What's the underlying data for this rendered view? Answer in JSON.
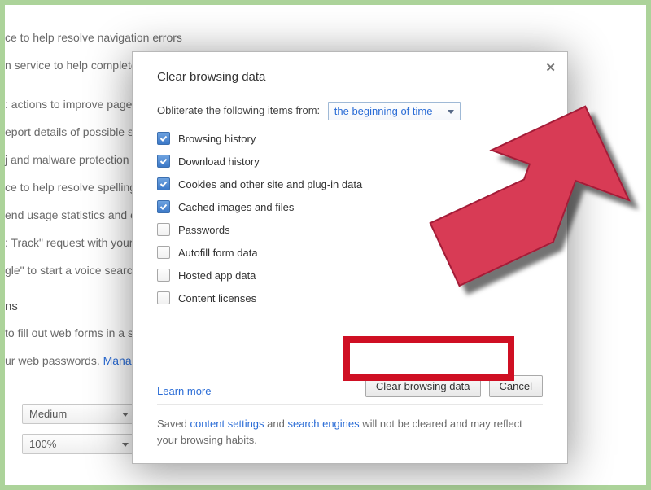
{
  "background": {
    "lines": {
      "l1": "ce to help resolve navigation errors",
      "l2": "n service to help complete seai",
      "l3": ": actions to improve page load",
      "l4": "eport details of possible secur",
      "l5": "j and malware protection",
      "l6": "ce to help resolve spelling err",
      "l7": "end usage statistics and crash",
      "l8": ": Track\" request with your bro",
      "l9": "gle\" to start a voice search",
      "l10": "ns",
      "l11": "to fill out web forms in a singl",
      "l12_a": "ur web passwords.  ",
      "l12_b": "Manage p"
    },
    "dropdowns": {
      "medium": "Medium",
      "zoom": "100%"
    }
  },
  "modal": {
    "title": "Clear browsing data",
    "obliterate_label": "Obliterate the following items from:",
    "time_range": "the beginning of time",
    "options": [
      {
        "label": "Browsing history",
        "checked": true
      },
      {
        "label": "Download history",
        "checked": true
      },
      {
        "label": "Cookies and other site and plug-in data",
        "checked": true
      },
      {
        "label": "Cached images and files",
        "checked": true
      },
      {
        "label": "Passwords",
        "checked": false
      },
      {
        "label": "Autofill form data",
        "checked": false
      },
      {
        "label": "Hosted app data",
        "checked": false
      },
      {
        "label": "Content licenses",
        "checked": false
      }
    ],
    "learn_more": "Learn more",
    "clear_button": "Clear browsing data",
    "cancel_button": "Cancel",
    "footer_pre": "Saved ",
    "footer_link1": "content settings",
    "footer_mid": "  and  ",
    "footer_link2": "search engines",
    "footer_post": "  will not be cleared and may reflect your browsing habits."
  }
}
